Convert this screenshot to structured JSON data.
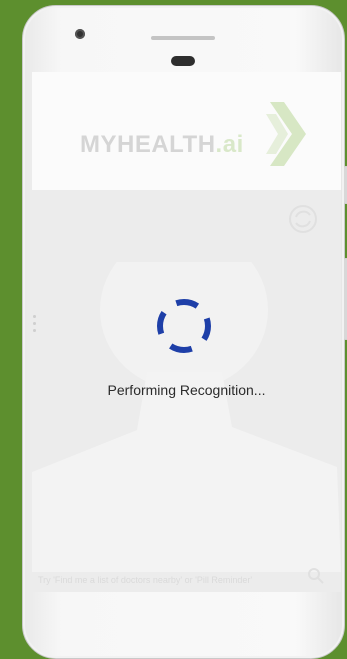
{
  "device": {
    "background_color": "#5d8f2e"
  },
  "app": {
    "logo_text": "MYHEALTH",
    "logo_suffix": ".ai",
    "brand_color": "#9cc46e"
  },
  "camera": {
    "switch_icon": "camera-switch-icon"
  },
  "status": {
    "loading_text": "Performing Recognition...",
    "spinner_color": "#1e3fa8"
  },
  "search": {
    "placeholder": "Try 'Find me a list of doctors nearby' or 'Pill Reminder'",
    "icon": "search-icon"
  }
}
